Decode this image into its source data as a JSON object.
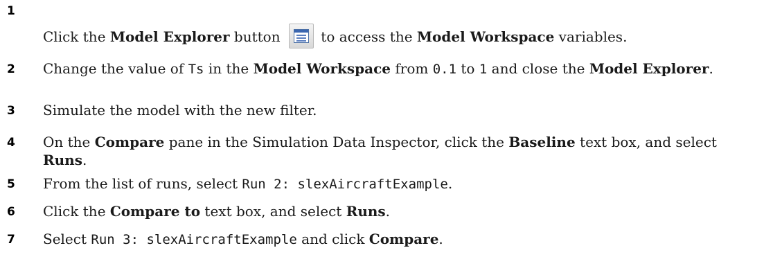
{
  "steps": [
    {
      "number": "1",
      "parts": {
        "a": "Click the ",
        "b": "Model Explorer",
        "c": " button ",
        "d": " to access the ",
        "e": "Model Workspace",
        "f": " variables."
      },
      "icon": "model-explorer-icon"
    },
    {
      "number": "2",
      "parts": {
        "a": "Change the value of ",
        "b": "Ts",
        "c": " in the ",
        "d": "Model Workspace",
        "e": " from ",
        "f": "0.1",
        "g": " to ",
        "h": "1",
        "i": " and close the ",
        "j": "Model Explorer",
        "k": "."
      }
    },
    {
      "number": "3",
      "parts": {
        "a": "Simulate the model with the new filter."
      }
    },
    {
      "number": "4",
      "parts": {
        "a": "On the ",
        "b": "Compare",
        "c": " pane in the Simulation Data Inspector, click the ",
        "d": "Baseline",
        "e": " text box, and select ",
        "f": "Runs",
        "g": "."
      }
    },
    {
      "number": "5",
      "parts": {
        "a": "From the list of runs, select ",
        "b": "Run 2: slexAircraftExample",
        "c": "."
      }
    },
    {
      "number": "6",
      "parts": {
        "a": "Click the ",
        "b": "Compare to",
        "c": " text box, and select ",
        "d": "Runs",
        "e": "."
      }
    },
    {
      "number": "7",
      "parts": {
        "a": "Select ",
        "b": "Run 3: slexAircraftExample",
        "c": " and click ",
        "d": "Compare",
        "e": "."
      }
    }
  ]
}
